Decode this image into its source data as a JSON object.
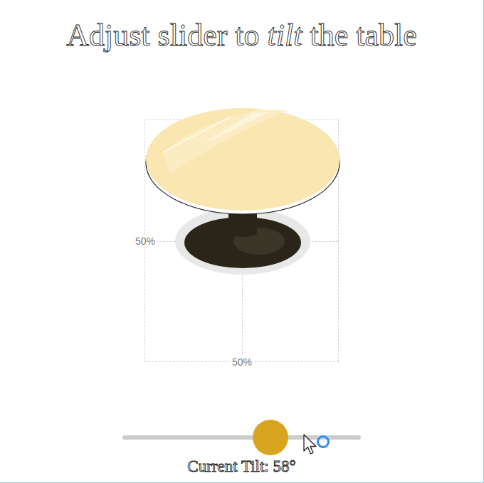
{
  "title": {
    "lead": "Adjust slider to",
    "emphasis": "tilt",
    "trail": "the table"
  },
  "guides": {
    "row_label": "50%",
    "column_label": "50%"
  },
  "slider": {
    "level": 0.62,
    "reading": "Current Tilt: 58°"
  }
}
